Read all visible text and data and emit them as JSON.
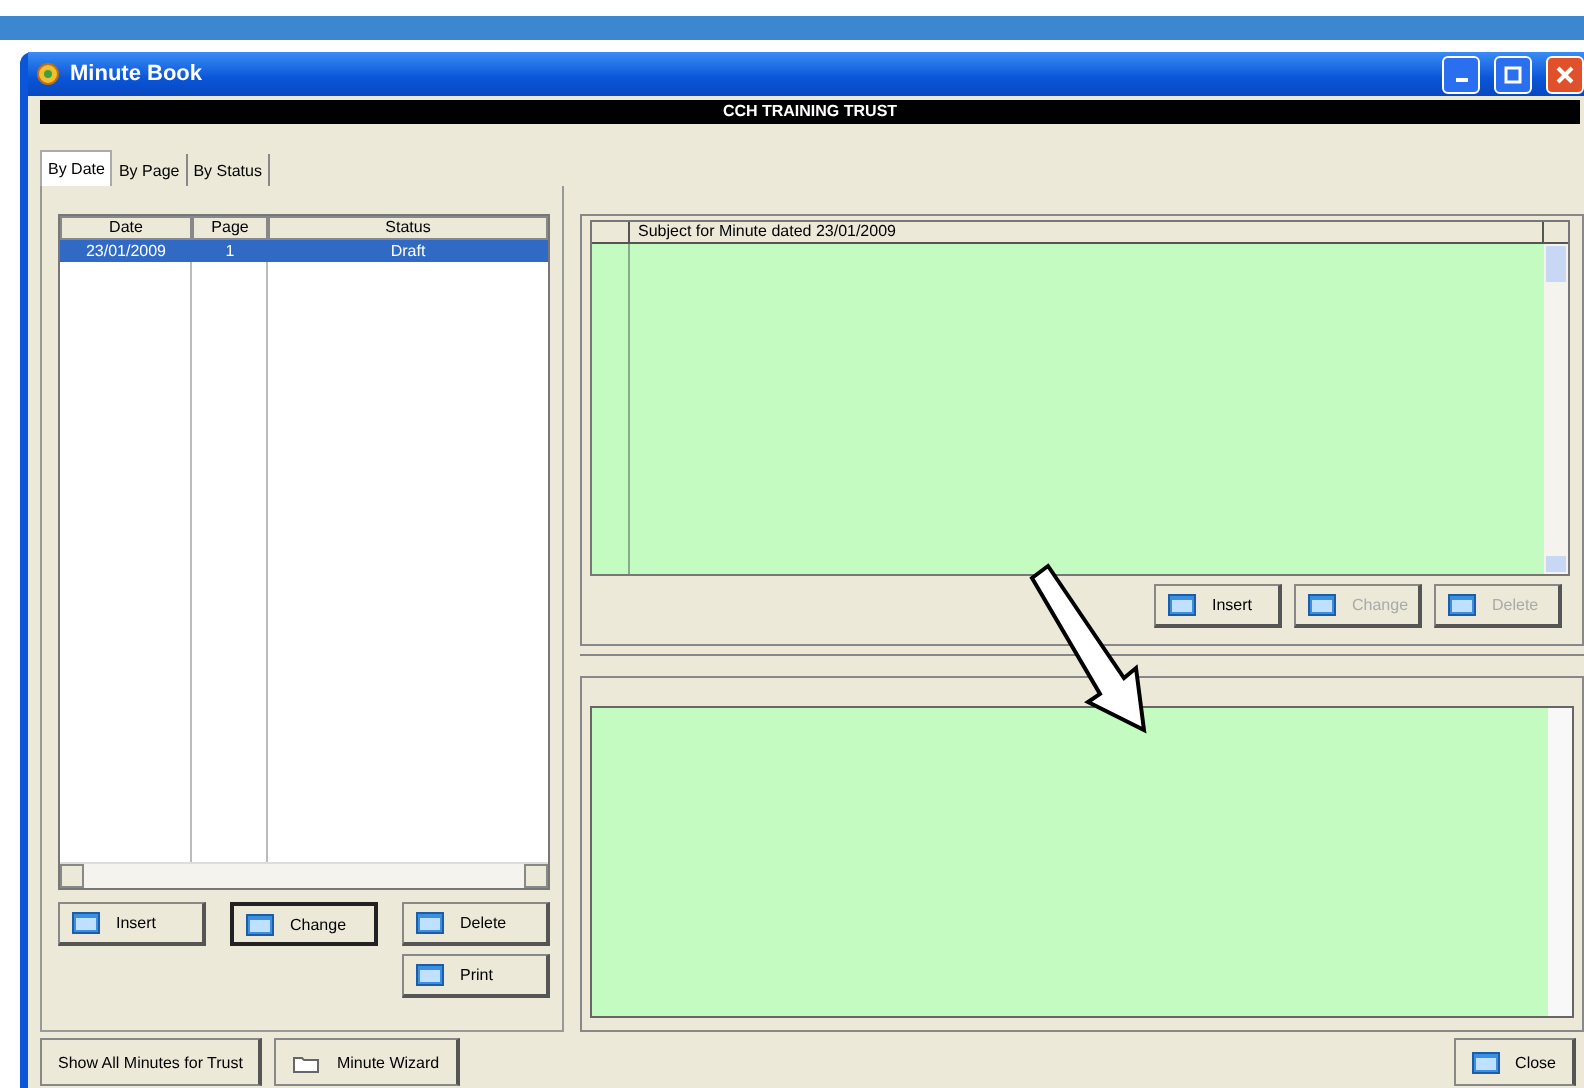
{
  "window": {
    "title": "Minute Book"
  },
  "header": "CCH TRAINING TRUST",
  "tabs": [
    {
      "label": "By Date",
      "selected": true
    },
    {
      "label": "By Page",
      "selected": false
    },
    {
      "label": "By Status",
      "selected": false
    }
  ],
  "minutes_table": {
    "columns": [
      "Date",
      "Page",
      "Status"
    ],
    "rows": [
      {
        "cells": [
          "23/01/2009",
          "1",
          "Draft"
        ],
        "selected": true
      }
    ]
  },
  "left_buttons": [
    {
      "label": "Insert",
      "focused": false,
      "disabled": false
    },
    {
      "label": "Change",
      "focused": true,
      "disabled": false
    },
    {
      "label": "Delete",
      "focused": false,
      "disabled": false
    },
    {
      "label": "Print",
      "focused": false,
      "disabled": false
    }
  ],
  "subject_grid": {
    "heading": "Subject for Minute dated 23/01/2009"
  },
  "subject_buttons": [
    {
      "label": "Insert",
      "disabled": false
    },
    {
      "label": "Change",
      "disabled": true
    },
    {
      "label": "Delete",
      "disabled": true
    }
  ],
  "footer_buttons": [
    {
      "label": "Show All Minutes for Trust",
      "kind": "plain"
    },
    {
      "label": "Minute Wizard",
      "kind": "folder"
    }
  ],
  "close_button": {
    "label": "Close"
  }
}
